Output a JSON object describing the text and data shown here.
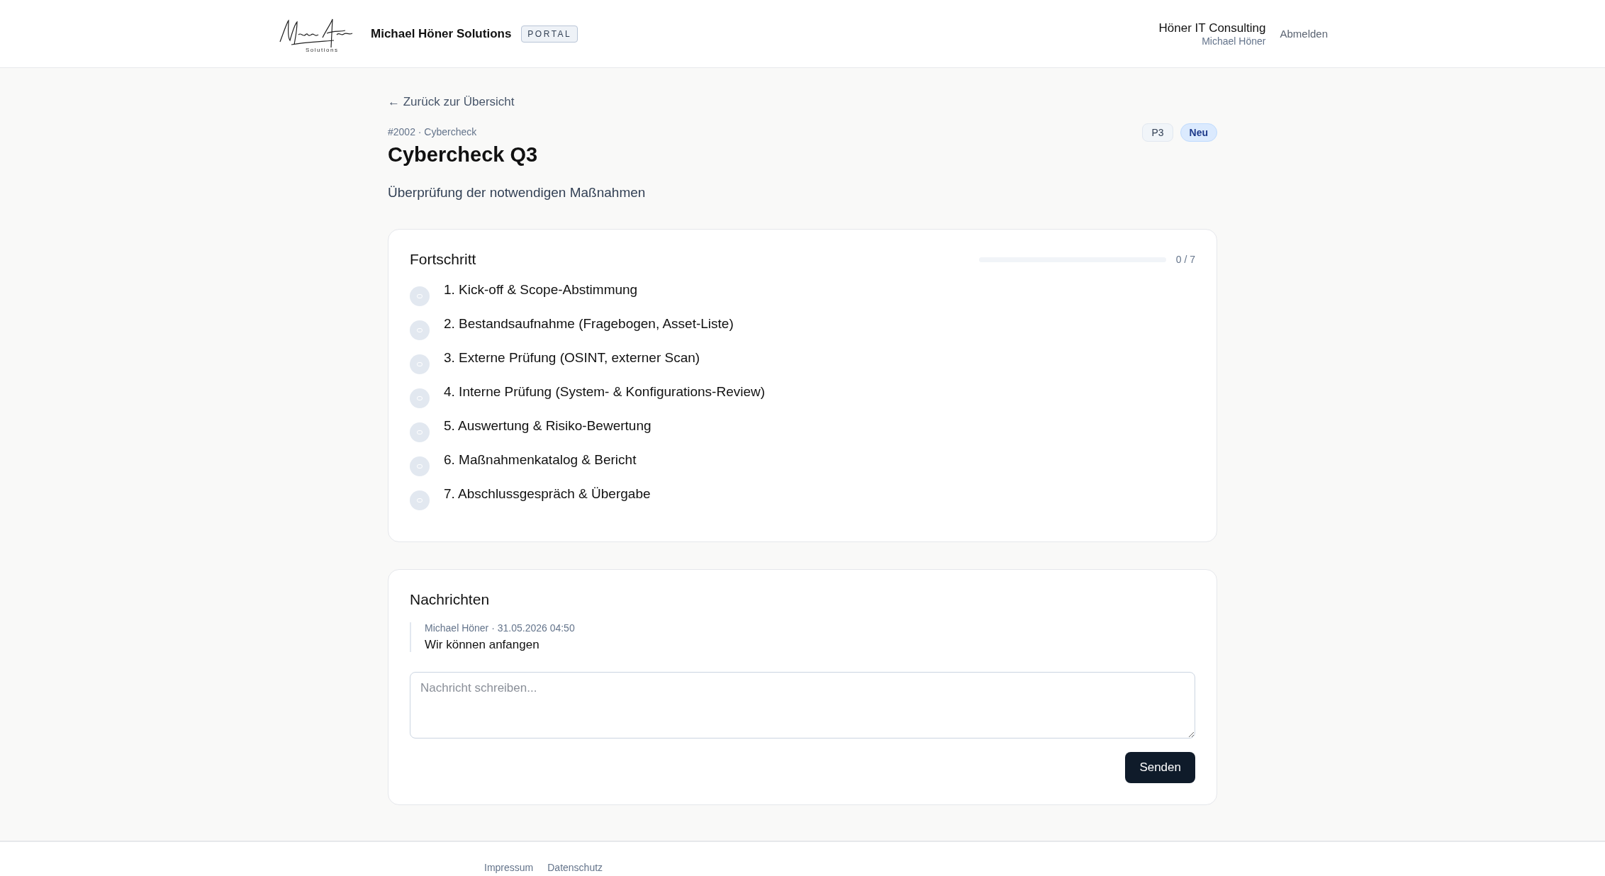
{
  "header": {
    "logo_subtitle": "Solutions",
    "brand": "Michael Höner Solutions",
    "badge": "PORTAL",
    "company": "Höner IT Consulting",
    "user": "Michael Höner",
    "logout": "Abmelden"
  },
  "back_link": "← Zurück zur Übersicht",
  "ticket": {
    "meta": "#2002 · Cybercheck",
    "title": "Cybercheck Q3",
    "description": "Überprüfung der notwendigen Maßnahmen",
    "tags": [
      {
        "label": "P3",
        "kind": "priority"
      },
      {
        "label": "Neu",
        "kind": "status"
      }
    ]
  },
  "progress": {
    "title": "Fortschritt",
    "level": 0,
    "count": "0 / 7",
    "steps": [
      {
        "label": "1. Kick-off & Scope-Abstimmung",
        "done": false
      },
      {
        "label": "2. Bestandsaufnahme (Fragebogen, Asset-Liste)",
        "done": false
      },
      {
        "label": "3. Externe Prüfung (OSINT, externer Scan)",
        "done": false
      },
      {
        "label": "4. Interne Prüfung (System- & Konfigurations-Review)",
        "done": false
      },
      {
        "label": "5. Auswertung & Risiko-Bewertung",
        "done": false
      },
      {
        "label": "6. Maßnahmenkatalog & Bericht",
        "done": false
      },
      {
        "label": "7. Abschlussgespräch & Übergabe",
        "done": false
      }
    ]
  },
  "messages": {
    "title": "Nachrichten",
    "items": [
      {
        "meta": "Michael Höner · 31.05.2026 04:50",
        "text": "Wir können anfangen"
      }
    ],
    "placeholder": "Nachricht schreiben...",
    "send": "Senden"
  },
  "footer": {
    "links": [
      "Impressum",
      "Datenschutz"
    ]
  }
}
